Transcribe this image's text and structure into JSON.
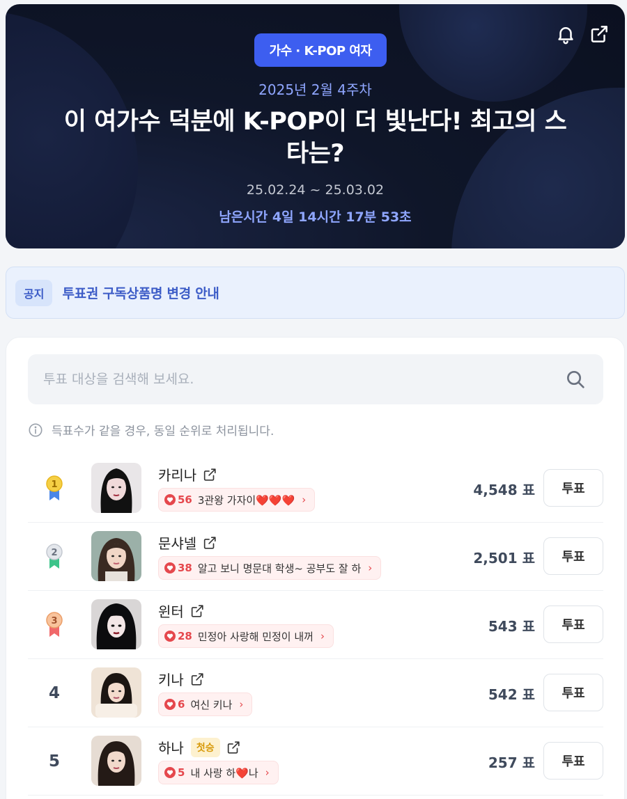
{
  "hero": {
    "category": "가수 · K-POP 여자",
    "week": "2025년 2월 4주차",
    "title": "이 여가수 덕분에 K-POP이 더 빛난다! 최고의 스타는?",
    "date_range": "25.02.24 ~ 25.03.02",
    "remaining": "남은시간 4일 14시간 17분 53초",
    "icons": [
      "bell-icon",
      "share-icon"
    ]
  },
  "notice": {
    "tag": "공지",
    "text": "투표권 구독상품명 변경 안내"
  },
  "search": {
    "placeholder": "투표 대상을 검색해 보세요."
  },
  "tie_note": "득표수가 같을 경우, 동일 순위로 처리됩니다.",
  "colors": {
    "accent": "#3d5ef0",
    "cheer_red": "#e5484d",
    "gold": "#f2c230",
    "silver": "#b9c0ca",
    "bronze": "#f0a070"
  },
  "rankings": [
    {
      "rank": "1",
      "name": "카리나",
      "cheer_count": "56",
      "cheer_msg": "3관왕 가자이❤️❤️❤️",
      "votes": "4,548 표",
      "vote_label": "투표",
      "first_badge": "",
      "medal": "gold"
    },
    {
      "rank": "2",
      "name": "문샤넬",
      "cheer_count": "38",
      "cheer_msg": "알고 보니 명문대 학생~ 공부도 잘 하",
      "votes": "2,501 표",
      "vote_label": "투표",
      "first_badge": "",
      "medal": "silver"
    },
    {
      "rank": "3",
      "name": "윈터",
      "cheer_count": "28",
      "cheer_msg": "민정아 사랑해 민정이 내꺼",
      "votes": "543 표",
      "vote_label": "투표",
      "first_badge": "",
      "medal": "bronze"
    },
    {
      "rank": "4",
      "name": "키나",
      "cheer_count": "6",
      "cheer_msg": "여신 키나",
      "votes": "542 표",
      "vote_label": "투표",
      "first_badge": "",
      "medal": ""
    },
    {
      "rank": "5",
      "name": "하나",
      "cheer_count": "5",
      "cheer_msg": "내 사랑 하❤️나",
      "votes": "257 표",
      "vote_label": "투표",
      "first_badge": "첫승",
      "medal": ""
    }
  ]
}
